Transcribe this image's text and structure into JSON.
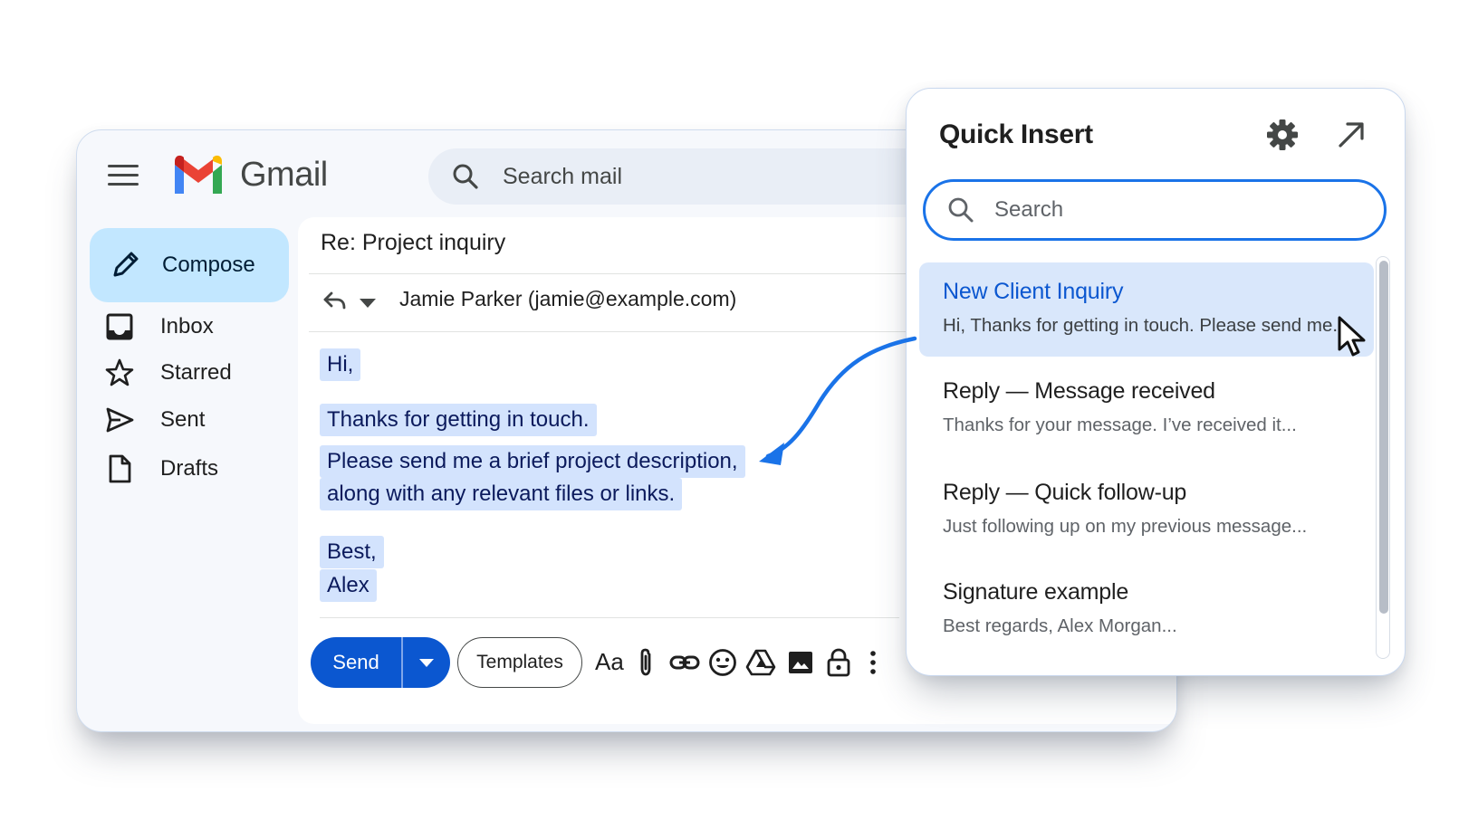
{
  "gmail": {
    "app_name": "Gmail",
    "search_placeholder": "Search mail",
    "compose_label": "Compose",
    "nav": [
      {
        "label": "Inbox",
        "icon": "inbox-icon"
      },
      {
        "label": "Starred",
        "icon": "star-icon"
      },
      {
        "label": "Sent",
        "icon": "send-icon"
      },
      {
        "label": "Drafts",
        "icon": "draft-icon"
      }
    ],
    "message": {
      "subject": "Re: Project inquiry",
      "recipient": "Jamie Parker (jamie@example.com)",
      "body": {
        "greeting": "Hi,",
        "line1": "Thanks for getting in touch.",
        "line2": "Please send me a brief project description,",
        "line3": "along with any relevant files or links.",
        "signoff": "Best,",
        "name": "Alex"
      }
    },
    "toolbar": {
      "send_label": "Send",
      "templates_label": "Templates",
      "format_label": "Aa",
      "icons": [
        "format-text-icon",
        "attach-icon",
        "link-icon",
        "emoji-icon",
        "drive-icon",
        "photo-icon",
        "lock-icon",
        "more-vertical-icon"
      ]
    }
  },
  "quick_insert": {
    "title": "Quick Insert",
    "search_placeholder": "Search",
    "items": [
      {
        "title": "New Client Inquiry",
        "preview": "Hi, Thanks for getting in touch. Please send me...",
        "active": true
      },
      {
        "title": "Reply — Message received",
        "preview": "Thanks for your message. I’ve received it..."
      },
      {
        "title": "Reply — Quick follow-up",
        "preview": "Just following up on my previous message..."
      },
      {
        "title": "Signature example",
        "preview": "Best regards, Alex Morgan..."
      }
    ]
  },
  "colors": {
    "accent": "#0b57d0",
    "highlight": "#d3e3fd",
    "compose_bg": "#c2e7ff",
    "search_border": "#1a73e8",
    "insert_arrow": "#1a73e8"
  }
}
